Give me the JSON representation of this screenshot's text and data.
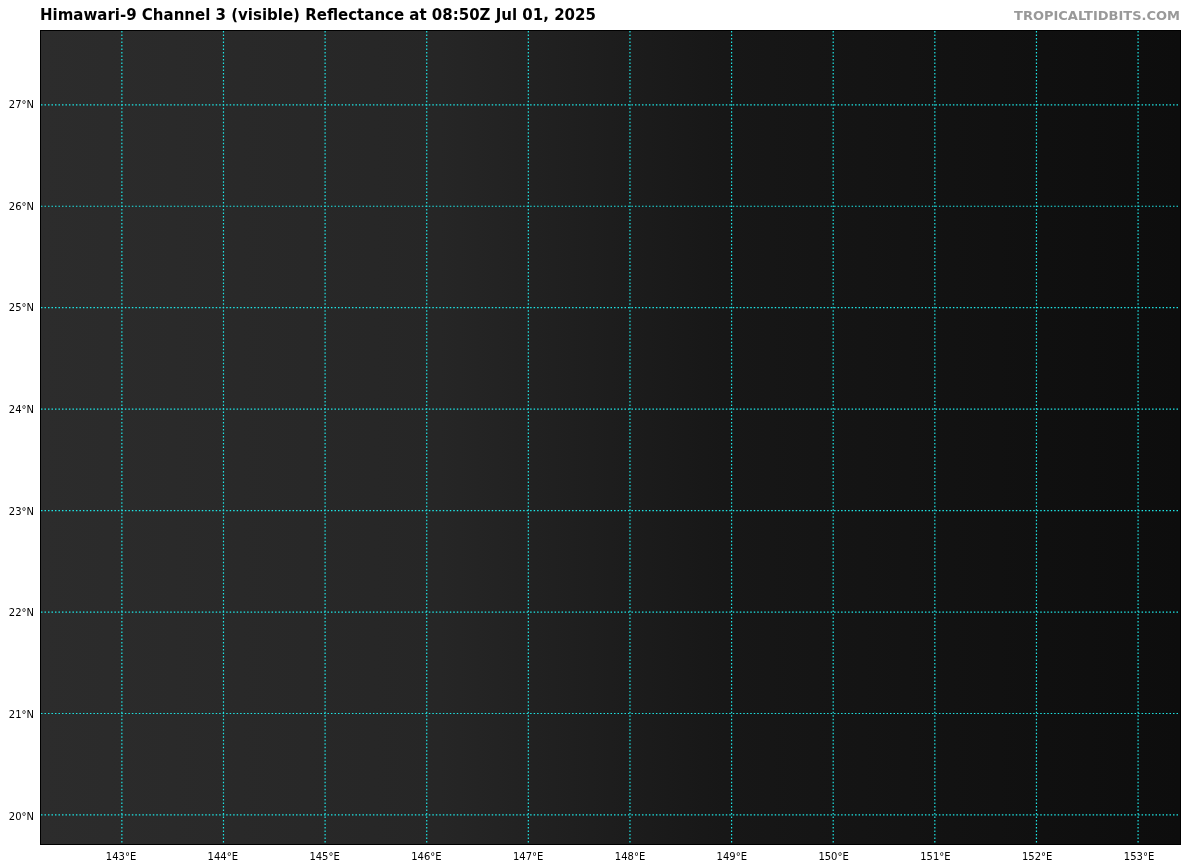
{
  "title": "Himawari-9 Channel 3 (visible) Reflectance at 08:50Z Jul 01, 2025",
  "source_label": "TROPICALTIDBITS.COM",
  "map": {
    "lat_labels": [
      "27°N",
      "26°N",
      "25°N",
      "24°N",
      "23°N",
      "22°N",
      "21°N",
      "20°N"
    ],
    "lon_labels": [
      "143°E",
      "144°E",
      "145°E",
      "146°E",
      "147°E",
      "148°E",
      "149°E",
      "150°E",
      "151°E",
      "152°E",
      "153°E"
    ]
  }
}
